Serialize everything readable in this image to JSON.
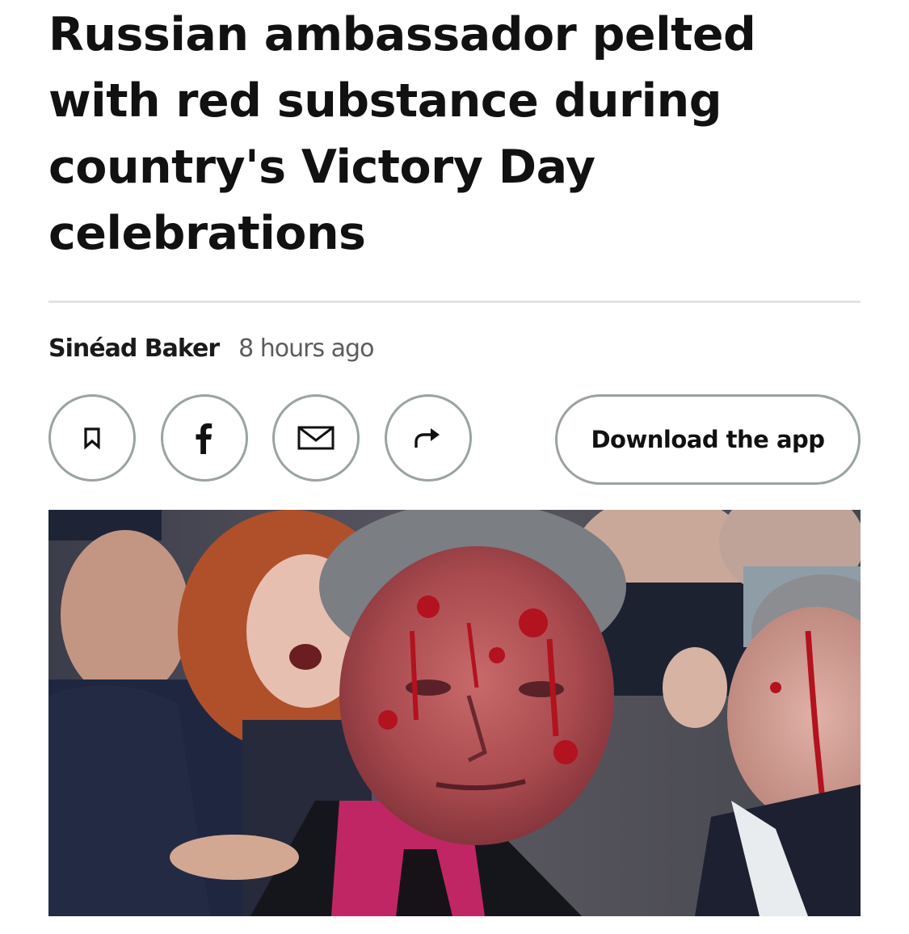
{
  "article": {
    "headline": "Russian ambassador pelted with red substance during country's Victory Day celebrations",
    "author": "Sinéad Baker",
    "timestamp": "8 hours ago"
  },
  "actions": {
    "bookmark_icon": "bookmark-icon",
    "facebook_icon": "facebook-icon",
    "email_icon": "mail-icon",
    "share_icon": "share-icon",
    "download_label": "Download the app"
  },
  "colors": {
    "text": "#111111",
    "muted": "#5c5c5c",
    "button_border": "#9aa3a3",
    "divider": "#e3e3e3",
    "red_substance": "#b3121f"
  }
}
